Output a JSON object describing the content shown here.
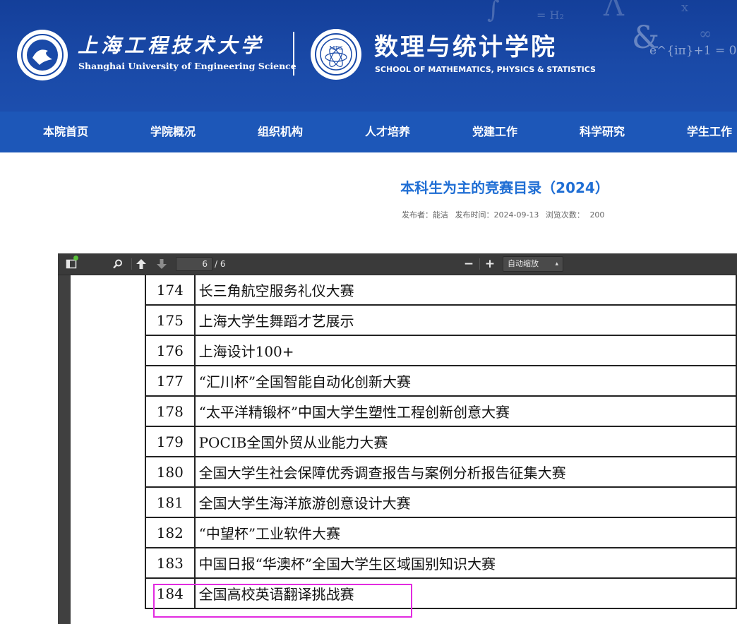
{
  "header": {
    "university_name_cn": "上海工程技术大学",
    "university_name_en": "Shanghai University of Engineering Science",
    "school_name_cn": "数理与统计学院",
    "school_name_en": "SCHOOL OF MATHEMATICS, PHYSICS & STATISTICS",
    "school_seal_text": "MPS",
    "decor_formula": "e^{iπ}+1 = 0"
  },
  "nav": {
    "items": [
      "本院首页",
      "学院概况",
      "组织机构",
      "人才培养",
      "党建工作",
      "科学研究",
      "学生工作"
    ]
  },
  "article": {
    "title": "本科生为主的竞赛目录（2024）",
    "publisher_label": "发布者：",
    "publisher": "能洁",
    "publish_time_label": "发布时间：",
    "publish_time": "2024-09-13",
    "views_label": "浏览次数：",
    "views": "200"
  },
  "pdf_viewer": {
    "current_page": "6",
    "total_pages": "/ 6",
    "zoom_label": "自动缩放",
    "zoom_out_label": "−",
    "zoom_in_label": "+",
    "icons": [
      "sidebar-toggle-icon",
      "search-icon",
      "previous-page-icon",
      "next-page-icon"
    ],
    "highlight_color": "#e22be0",
    "table_rows": [
      {
        "num": "174",
        "name": "长三角航空服务礼仪大赛"
      },
      {
        "num": "175",
        "name": "上海大学生舞蹈才艺展示"
      },
      {
        "num": "176",
        "name": "上海设计100+"
      },
      {
        "num": "177",
        "name": "“汇川杯”全国智能自动化创新大赛"
      },
      {
        "num": "178",
        "name": "“太平洋精锻杯”中国大学生塑性工程创新创意大赛"
      },
      {
        "num": "179",
        "name": "POCIB全国外贸从业能力大赛"
      },
      {
        "num": "180",
        "name": "全国大学生社会保障优秀调查报告与案例分析报告征集大赛"
      },
      {
        "num": "181",
        "name": "全国大学生海洋旅游创意设计大赛"
      },
      {
        "num": "182",
        "name": "“中望杯”工业软件大赛"
      },
      {
        "num": "183",
        "name": "中国日报“华澳杯”全国大学生区域国别知识大赛"
      },
      {
        "num": "184",
        "name": "全国高校英语翻译挑战赛"
      }
    ]
  }
}
